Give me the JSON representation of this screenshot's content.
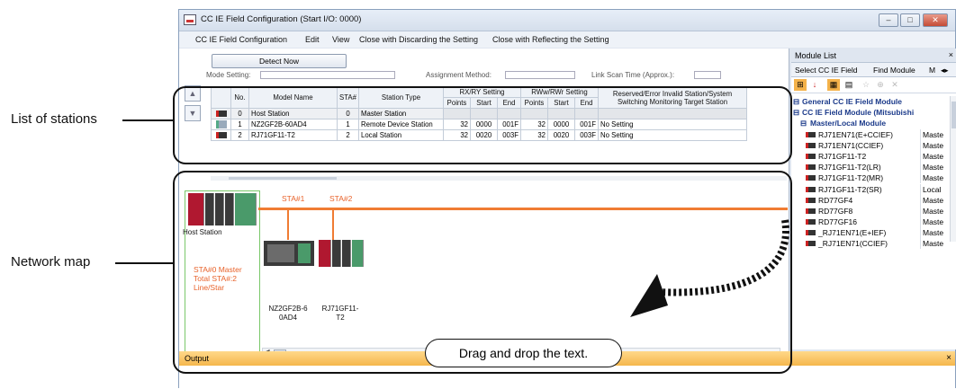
{
  "callouts": {
    "stations": "List of stations",
    "network": "Network map",
    "drag": "Drag and drop the text."
  },
  "window": {
    "title": "CC IE Field Configuration (Start I/O: 0000)",
    "controls": {
      "minimize": "–",
      "maximize": "□",
      "close": "✕"
    }
  },
  "menu": [
    "CC IE Field Configuration",
    "Edit",
    "View",
    "Close with Discarding the Setting",
    "Close with Reflecting the Setting"
  ],
  "toolbar": {
    "detect_now": "Detect Now",
    "mode_setting": "Mode Setting:",
    "assignment_method": "Assignment Method:",
    "link_scan_time": "Link Scan Time (Approx.):"
  },
  "table": {
    "headers": {
      "no": "No.",
      "model": "Model Name",
      "sta": "STA#",
      "type": "Station Type",
      "rxry": "RX/RY Setting",
      "rwwrwr": "RWw/RWr Setting",
      "reserved": "Reserved/Error Invalid Station/System Switching Monitoring Target Station",
      "points": "Points",
      "start": "Start",
      "end": "End"
    },
    "rows": [
      {
        "no": "0",
        "model": "Host Station",
        "sta": "0",
        "type": "Master Station",
        "rx_points": "",
        "rx_start": "",
        "rx_end": "",
        "rw_points": "",
        "rw_start": "",
        "rw_end": "",
        "reserved": ""
      },
      {
        "no": "1",
        "model": "NZ2GF2B-60AD4",
        "sta": "1",
        "type": "Remote Device Station",
        "rx_points": "32",
        "rx_start": "0000",
        "rx_end": "001F",
        "rw_points": "32",
        "rw_start": "0000",
        "rw_end": "001F",
        "reserved": "No Setting"
      },
      {
        "no": "2",
        "model": "RJ71GF11-T2",
        "sta": "2",
        "type": "Local Station",
        "rx_points": "32",
        "rx_start": "0020",
        "rx_end": "003F",
        "rw_points": "32",
        "rw_start": "0020",
        "rw_end": "003F",
        "reserved": "No Setting"
      }
    ]
  },
  "network_map": {
    "sta1": "STA#1",
    "sta2": "STA#2",
    "host_label": "Host Station",
    "host_info": [
      "STA#0  Master",
      "Total STA#:2",
      "Line/Star"
    ],
    "station1_label": [
      "NZ2GF2B-6",
      "0AD4"
    ],
    "station2_label": [
      "RJ71GF11-",
      "T2"
    ]
  },
  "output": {
    "title": "Output",
    "close": "×"
  },
  "module_list": {
    "title": "Module List",
    "close": "×",
    "tabs": [
      "Select CC IE Field",
      "Find Module",
      "M"
    ],
    "items": [
      {
        "kind": "cat1",
        "name": "General CC IE Field Module",
        "type": ""
      },
      {
        "kind": "cat1",
        "name": "CC IE Field Module (Mitsubishi",
        "type": ""
      },
      {
        "kind": "cat2",
        "name": "Master/Local Module",
        "type": ""
      },
      {
        "kind": "item",
        "name": "RJ71EN71(E+CCIEF)",
        "type": "Maste"
      },
      {
        "kind": "item",
        "name": "RJ71EN71(CCIEF)",
        "type": "Maste"
      },
      {
        "kind": "item",
        "name": "RJ71GF11-T2",
        "type": "Maste"
      },
      {
        "kind": "item",
        "name": "RJ71GF11-T2(LR)",
        "type": "Maste"
      },
      {
        "kind": "item",
        "name": "RJ71GF11-T2(MR)",
        "type": "Maste"
      },
      {
        "kind": "item",
        "name": "RJ71GF11-T2(SR)",
        "type": "Local"
      },
      {
        "kind": "item",
        "name": "RD77GF4",
        "type": "Maste"
      },
      {
        "kind": "item",
        "name": "RD77GF8",
        "type": "Maste"
      },
      {
        "kind": "item",
        "name": "RD77GF16",
        "type": "Maste"
      },
      {
        "kind": "item",
        "name": "_RJ71EN71(E+IEF)",
        "type": "Maste"
      },
      {
        "kind": "item",
        "name": "_RJ71EN71(CCIEF)",
        "type": "Maste"
      }
    ]
  },
  "colors": {
    "accent_orange": "#f07c33",
    "selection_green": "#7ac86a",
    "output_header": "#f5b74c"
  }
}
